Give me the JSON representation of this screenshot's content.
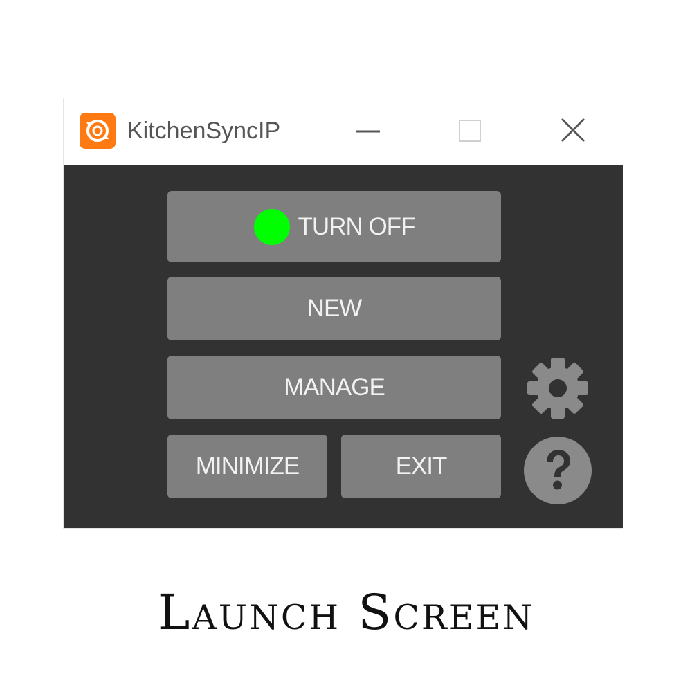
{
  "window": {
    "title": "KitchenSyncIP",
    "app_icon": "orange-sync-icon",
    "controls": {
      "minimize_icon": "minimize-icon",
      "maximize_icon": "maximize-icon",
      "close_icon": "close-icon"
    }
  },
  "main": {
    "turn_off_label": "TURN OFF",
    "status_indicator_color": "#00ff00",
    "new_label": "NEW",
    "manage_label": "MANAGE",
    "minimize_label": "MINIMIZE",
    "exit_label": "EXIT",
    "settings_icon": "gear-icon",
    "help_icon": "question-mark-icon"
  },
  "caption": "Launch Screen",
  "colors": {
    "app_icon": "#ff7a12",
    "window_background": "#323232",
    "button_background": "#7f7f7f",
    "button_text": "#f2f2f2",
    "icon_gray": "#8a8a8a"
  }
}
